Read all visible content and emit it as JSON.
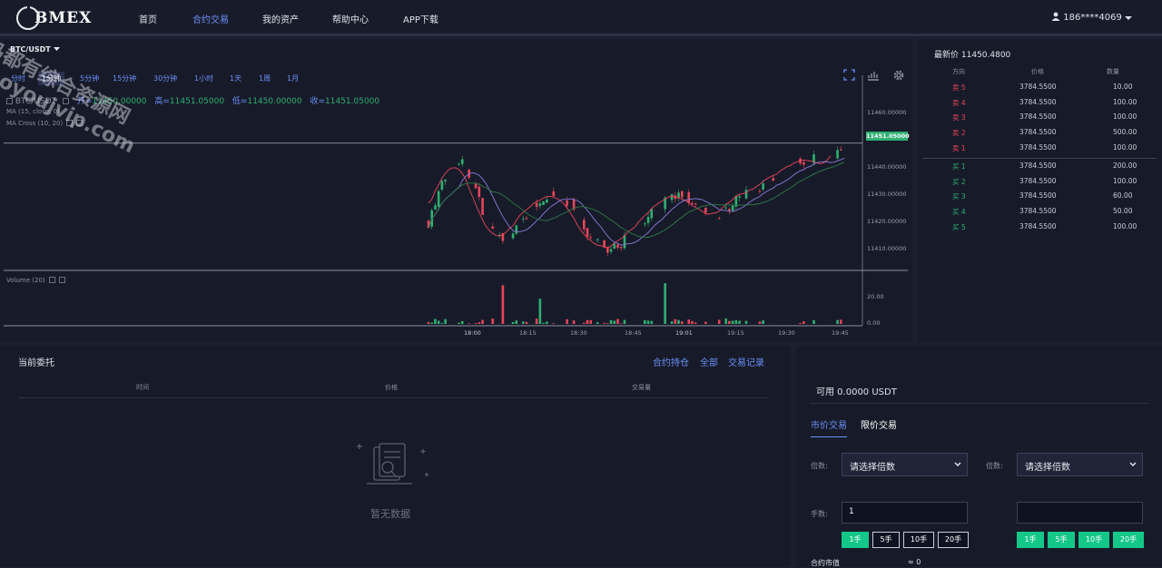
{
  "nav": {
    "brand": "BMEX",
    "items": [
      "首页",
      "合约交易",
      "我的资产",
      "帮助中心",
      "APP下载"
    ],
    "active_index": 1,
    "user": "186****4069"
  },
  "chart": {
    "pair": "BTC/USDT",
    "timeframes": [
      "分时",
      "1分钟",
      "5分钟",
      "15分钟",
      "30分钟",
      "1小时",
      "1天",
      "1周",
      "1月"
    ],
    "active_timeframe": 1,
    "symbol": "BTC/USDT",
    "ohlc": {
      "open_label": "开=",
      "open": "11450.00000",
      "high_label": "高=",
      "high": "11451.05000",
      "low_label": "低=",
      "low": "11450.00000",
      "close_label": "收=",
      "close": "11451.05000"
    },
    "ma_label": "MA (15, close, 0)",
    "macross_label": "MA Cross (10, 20)",
    "volume_label": "Volume (20)",
    "current_price_tag": "11451.05000",
    "price_ticks": [
      "11460.00000",
      "11440.00000",
      "11430.00000",
      "11420.00000",
      "11410.00000"
    ],
    "volume_ticks": [
      "20.00",
      "0.00"
    ],
    "time_ticks": [
      "18:00",
      "18:15",
      "18:30",
      "18:45",
      "19:01",
      "19:15",
      "19:30",
      "19:45"
    ]
  },
  "chart_data": {
    "type": "candlestick",
    "x_range": [
      "17:45",
      "19:50"
    ],
    "ylim": [
      11405,
      11465
    ],
    "current_price": 11451.05,
    "series": [
      {
        "name": "MA (15, close, 0)"
      },
      {
        "name": "MA Cross (10, 20)"
      }
    ],
    "volume_ylim": [
      0,
      30
    ]
  },
  "orderbook": {
    "latest_label": "最新价",
    "latest_price": "11450.4800",
    "headers": [
      "方向",
      "价格",
      "数量"
    ],
    "sells": [
      {
        "side": "卖 5",
        "price": "3784.5500",
        "qty": "10.00"
      },
      {
        "side": "卖 4",
        "price": "3784.5500",
        "qty": "100.00"
      },
      {
        "side": "卖 3",
        "price": "3784.5500",
        "qty": "100.00"
      },
      {
        "side": "卖 2",
        "price": "3784.5500",
        "qty": "500.00"
      },
      {
        "side": "卖 1",
        "price": "3784.5500",
        "qty": "100.00"
      }
    ],
    "buys": [
      {
        "side": "买 1",
        "price": "3784.5500",
        "qty": "200.00"
      },
      {
        "side": "买 2",
        "price": "3784.5500",
        "qty": "100.00"
      },
      {
        "side": "买 3",
        "price": "3784.5500",
        "qty": "60.00"
      },
      {
        "side": "买 4",
        "price": "3784.5500",
        "qty": "50.00"
      },
      {
        "side": "买 5",
        "price": "3784.5500",
        "qty": "100.00"
      }
    ]
  },
  "orders": {
    "title": "当前委托",
    "links": [
      "合约持仓",
      "全部",
      "交易记录"
    ],
    "headers": [
      "时间",
      "价格",
      "交易量"
    ],
    "empty": "暂无数据"
  },
  "trade": {
    "available": "可用 0.0000 USDT",
    "tabs": [
      "市价交易",
      "限价交易"
    ],
    "multiplier_label": "倍数:",
    "multiplier_placeholder": "请选择倍数",
    "hands_label": "手数:",
    "hands_value": "1",
    "quick": [
      "1手",
      "5手",
      "10手",
      "20手"
    ],
    "contract_value_label": "合约市值",
    "contract_value": "≈ 0"
  },
  "watermark": [
    "马都有综合资源网",
    "dooyoujvip.com"
  ]
}
